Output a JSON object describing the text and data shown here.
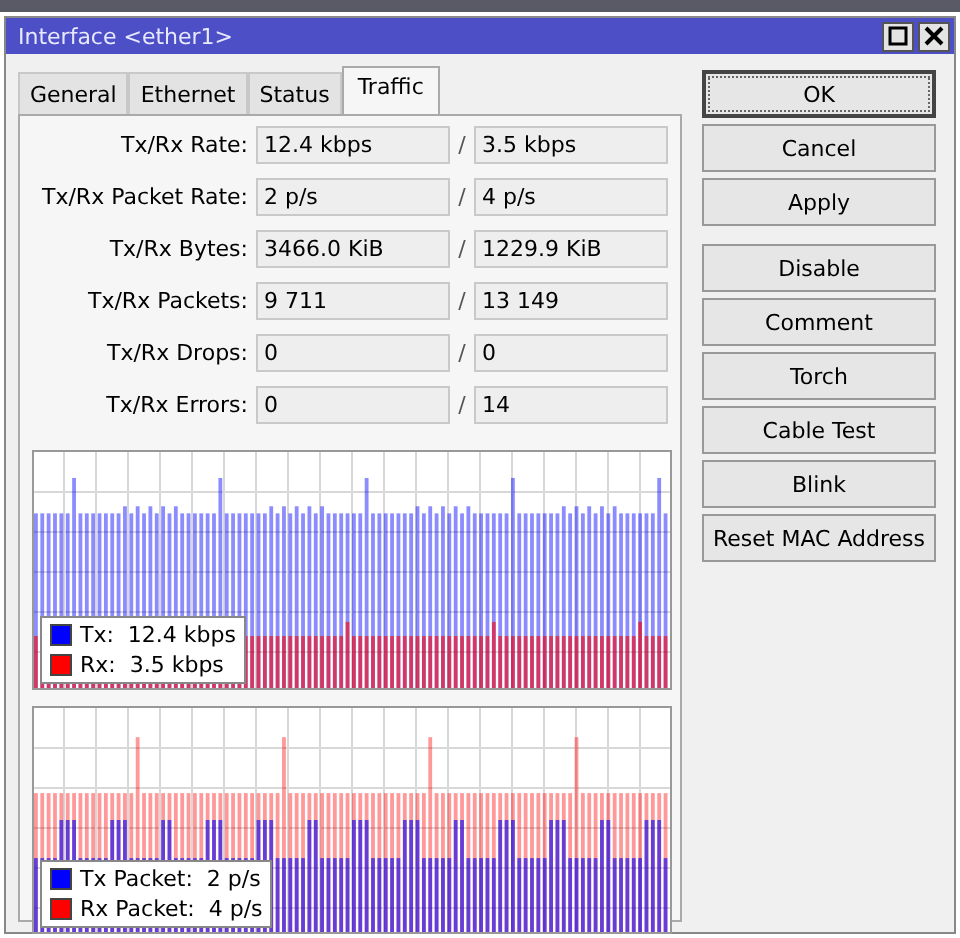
{
  "window": {
    "title": "Interface <ether1>"
  },
  "tabs": [
    {
      "label": "General",
      "selected": false
    },
    {
      "label": "Ethernet",
      "selected": false
    },
    {
      "label": "Status",
      "selected": false
    },
    {
      "label": "Traffic",
      "selected": true
    }
  ],
  "stats": [
    {
      "label": "Tx/Rx Rate:",
      "tx": "12.4 kbps",
      "separator": "/",
      "rx": "3.5 kbps"
    },
    {
      "label": "Tx/Rx Packet Rate:",
      "tx": "2 p/s",
      "separator": "/",
      "rx": "4 p/s"
    },
    {
      "label": "Tx/Rx Bytes:",
      "tx": "3466.0 KiB",
      "separator": "/",
      "rx": "1229.9 KiB"
    },
    {
      "label": "Tx/Rx Packets:",
      "tx": "9 711",
      "separator": "/",
      "rx": "13 149"
    },
    {
      "label": "Tx/Rx Drops:",
      "tx": "0",
      "separator": "/",
      "rx": "0"
    },
    {
      "label": "Tx/Rx Errors:",
      "tx": "0",
      "separator": "/",
      "rx": "14"
    }
  ],
  "graphs": [
    {
      "kind": "rate",
      "legend": [
        {
          "label": "Tx:  12.4 kbps",
          "color": "#0000ff"
        },
        {
          "label": "Rx:  3.5 kbps",
          "color": "#ff0000"
        }
      ]
    },
    {
      "kind": "packets",
      "legend": [
        {
          "label": "Tx Packet:  2 p/s",
          "color": "#0000ff"
        },
        {
          "label": "Rx Packet:  4 p/s",
          "color": "#ff0000"
        }
      ]
    }
  ],
  "buttons": [
    {
      "label": "OK",
      "default": true
    },
    {
      "label": "Cancel",
      "default": false
    },
    {
      "label": "Apply",
      "default": false
    },
    {
      "label": "Disable",
      "default": false
    },
    {
      "label": "Comment",
      "default": false
    },
    {
      "label": "Torch",
      "default": false
    },
    {
      "label": "Cable Test",
      "default": false
    },
    {
      "label": "Blink",
      "default": false
    },
    {
      "label": "Reset MAC Address",
      "default": false
    }
  ]
}
